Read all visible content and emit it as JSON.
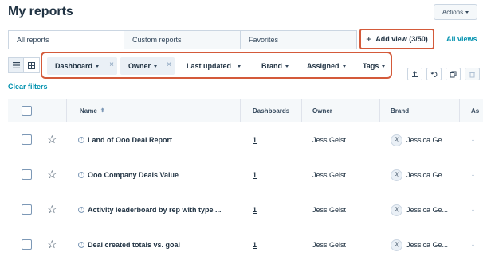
{
  "page": {
    "title": "My reports",
    "actions_label": "Actions"
  },
  "tabs": [
    {
      "label": "All reports"
    },
    {
      "label": "Custom reports"
    },
    {
      "label": "Favorites"
    }
  ],
  "add_view": {
    "label": "Add view (3/50)"
  },
  "all_views": {
    "label": "All views"
  },
  "filters": {
    "chips": [
      {
        "label": "Dashboard"
      },
      {
        "label": "Owner"
      }
    ],
    "dropdowns": [
      {
        "label": "Last updated"
      },
      {
        "label": "Brand"
      },
      {
        "label": "Assigned"
      },
      {
        "label": "Tags"
      }
    ],
    "clear_label": "Clear filters"
  },
  "table": {
    "columns": {
      "name": "Name",
      "dashboards": "Dashboards",
      "owner": "Owner",
      "brand": "Brand",
      "assigned": "As"
    },
    "rows": [
      {
        "name": "Land of Ooo Deal Report",
        "dashboards": "1",
        "owner": "Jess Geist",
        "brand_initials": "J(",
        "brand": "Jessica Ge...",
        "assigned": "-"
      },
      {
        "name": "Ooo Company Deals Value",
        "dashboards": "1",
        "owner": "Jess Geist",
        "brand_initials": "J(",
        "brand": "Jessica Ge...",
        "assigned": "-"
      },
      {
        "name": "Activity leaderboard by rep with type ...",
        "dashboards": "1",
        "owner": "Jess Geist",
        "brand_initials": "J(",
        "brand": "Jessica Ge...",
        "assigned": "-"
      },
      {
        "name": "Deal created totals vs. goal",
        "dashboards": "1",
        "owner": "Jess Geist",
        "brand_initials": "J(",
        "brand": "Jessica Ge...",
        "assigned": "-"
      }
    ]
  },
  "colors": {
    "accent_link": "#0091ae",
    "highlight_border": "#d45a3a"
  }
}
